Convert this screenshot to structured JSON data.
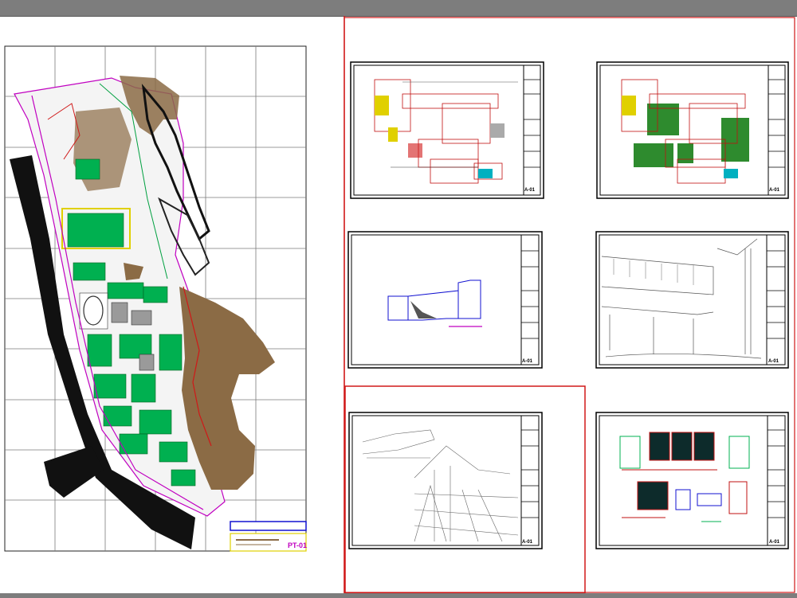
{
  "colors": {
    "background": "#ffffff",
    "chrome": "#7d7d7d",
    "viewport_border": "#d01818",
    "sheet_border": "#000000",
    "terrain": "#8b6b45",
    "vegetation": "#00b050",
    "title_block_accent": "#1010d0",
    "magenta": "#c000c0",
    "yellow_label": "#f0f000"
  },
  "site_plan": {
    "title_code": "PT-01",
    "grid_rows": 10,
    "grid_cols": 6
  },
  "sheets": [
    {
      "id": "sheet-floor-plan-1",
      "kind": "floor-plan",
      "code": "A-01",
      "selected": false
    },
    {
      "id": "sheet-floor-plan-2",
      "kind": "floor-plan-green",
      "code": "A-01",
      "selected": false
    },
    {
      "id": "sheet-section",
      "kind": "section",
      "code": "A-01",
      "selected": false
    },
    {
      "id": "sheet-perspective-1",
      "kind": "perspective",
      "code": "A-01",
      "selected": false
    },
    {
      "id": "sheet-perspective-2",
      "kind": "perspective",
      "code": "A-01",
      "selected": true
    },
    {
      "id": "sheet-details",
      "kind": "details",
      "code": "A-01",
      "selected": false
    }
  ]
}
